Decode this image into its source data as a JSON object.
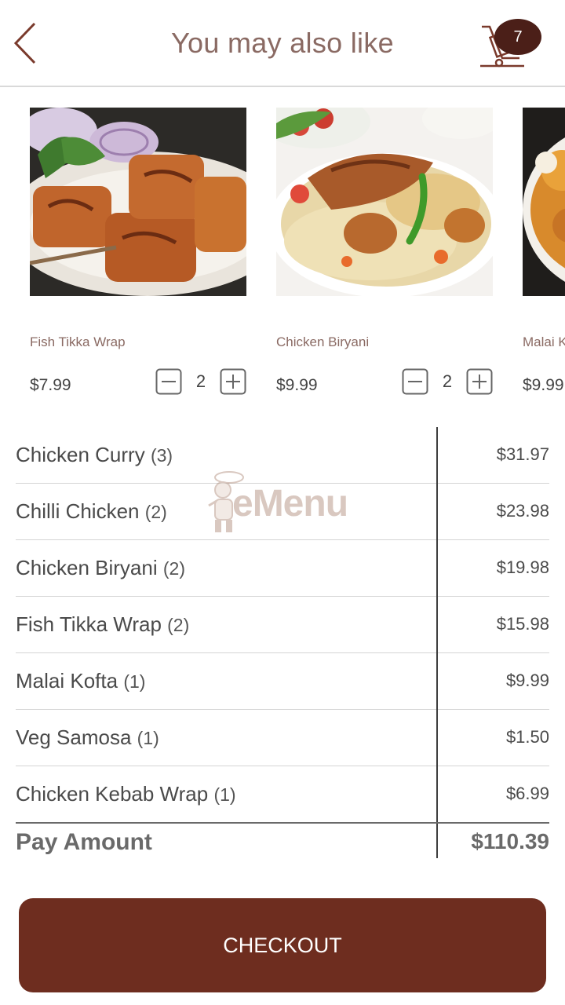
{
  "header": {
    "title": "You may also like",
    "back_icon": "chevron-left-icon",
    "cart_icon": "cart-icon",
    "cart_count": "7"
  },
  "suggestions": [
    {
      "name": "Fish Tikka Wrap",
      "price": "$7.99",
      "quantity": "2"
    },
    {
      "name": "Chicken Biryani",
      "price": "$9.99",
      "quantity": "2"
    },
    {
      "name": "Malai Kofta",
      "price": "$9.99"
    }
  ],
  "order": {
    "items": [
      {
        "name": "Chicken Curry",
        "qty": "(3)",
        "price": "$31.97"
      },
      {
        "name": "Chilli Chicken",
        "qty": "(2)",
        "price": "$23.98"
      },
      {
        "name": "Chicken Biryani",
        "qty": "(2)",
        "price": "$19.98"
      },
      {
        "name": "Fish Tikka Wrap",
        "qty": "(2)",
        "price": "$15.98"
      },
      {
        "name": "Malai Kofta",
        "qty": "(1)",
        "price": "$9.99"
      },
      {
        "name": "Veg Samosa",
        "qty": "(1)",
        "price": "$1.50"
      },
      {
        "name": "Chicken Kebab Wrap",
        "qty": "(1)",
        "price": "$6.99"
      }
    ],
    "total_label": "Pay Amount",
    "total_value": "$110.39"
  },
  "watermark": {
    "text": "eMenu"
  },
  "checkout": {
    "label": "CHECKOUT"
  },
  "colors": {
    "brand": "#6e2d1f",
    "badge": "#4b1f18",
    "title": "#8a6a63"
  }
}
